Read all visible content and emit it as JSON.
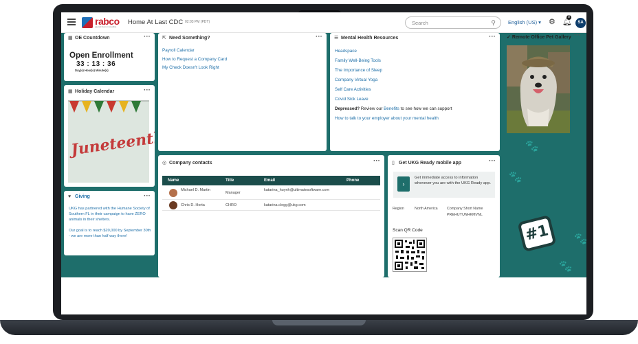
{
  "topbar": {
    "logo_word": "rabco",
    "logo_tagline": "payroll that is incredible",
    "site_title": "Home At Last CDC",
    "timestamp": "02:03 PM (PDT)",
    "search_placeholder": "Search",
    "language": "English (US) ▾",
    "notification_count": "8",
    "avatar_initials": "SA"
  },
  "oe_countdown": {
    "title": "OE Countdown",
    "heading": "Open Enrollment",
    "digits": "33 : 13 : 36",
    "units": "Day(s)  Hour(s)  Minute(s)"
  },
  "holiday": {
    "title": "Holiday Calendar",
    "image_text": "Juneteenth"
  },
  "giving": {
    "title": "Giving",
    "para1": "UKG has partnered with the Humane Society of Southern FL in their campaign to have ZERO animals in their shelters.",
    "para2": "Our goal is to reach $20,000 by September 30th - we are more than half way there!"
  },
  "need_something": {
    "title": "Need Something?",
    "links": [
      "Payroll Calendar",
      "How to Request a Company Card",
      "My Check Doesn't Look Right"
    ]
  },
  "mental_health": {
    "title": "Mental Health Resources",
    "links": [
      "Headspace",
      "Family Well-Being Tools",
      "The Importance of Sleep",
      "Company Virtual Yoga",
      "Self Care Activities",
      "Covid Sick Leave"
    ],
    "depressed_prefix": "Depressed?",
    "depressed_mid": " Review our ",
    "depressed_link": "Benefits",
    "depressed_suffix": " to see how we can support",
    "last_link": "How to talk to your employer about your mental health"
  },
  "contacts": {
    "title": "Company contacts",
    "headers": [
      "Name",
      "Title",
      "Email",
      "Phone"
    ],
    "rows": [
      {
        "name": "Michael D. Martin",
        "title": "Manager",
        "email": "katarina_huynh@ultimatesoftware.com",
        "phone": ""
      },
      {
        "name": "Chris D. Horta",
        "title": "CHRO",
        "email": "katarina.clegg@ukg.com",
        "phone": ""
      }
    ]
  },
  "mobile": {
    "title": "Get UKG Ready mobile app",
    "promo": "Get immediate access to information whenever you are with the UKG Ready app.",
    "region_label": "Region",
    "region_value": "North America",
    "short_name_label": "Company Short Name",
    "short_name_value": "PREHUYUNHKMVNL",
    "qr_label": "Scan QR Code"
  },
  "pet_gallery": {
    "title": "Remote Office Pet Gallery",
    "badge": "#1"
  },
  "colors": {
    "teal": "#1e6e6b",
    "link": "#1e6fa8",
    "header_dark": "#1b4d4b",
    "brand_red": "#c8202c"
  }
}
